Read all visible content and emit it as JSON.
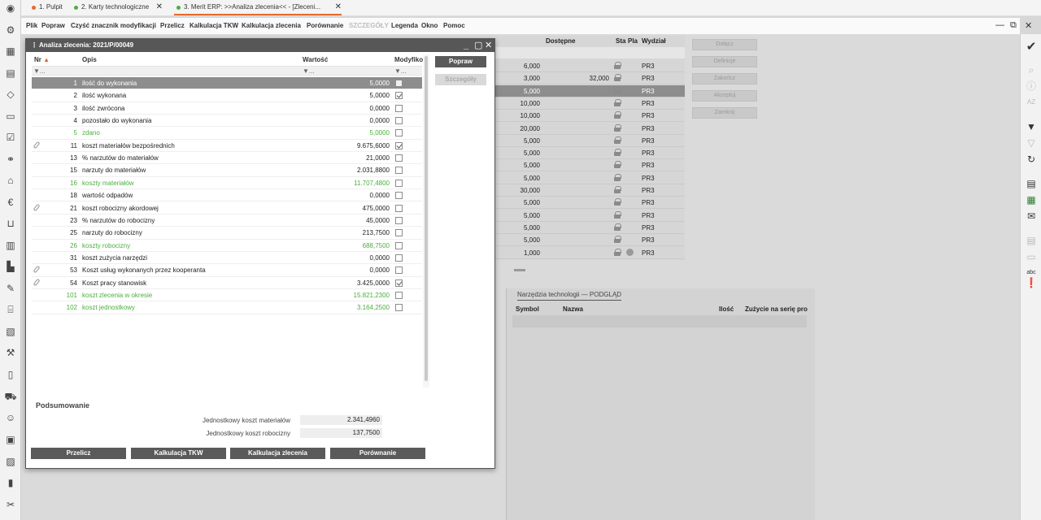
{
  "tabs": [
    {
      "label": "1. Pulpit",
      "dot": "#e36b2c",
      "closable": false
    },
    {
      "label": "2. Karty technologiczne",
      "dot": "#4caf3f",
      "closable": true
    },
    {
      "label": "3. Merit ERP: >>Analiza zlecenia<<  - [Zleceni...",
      "dot": "#4caf3f",
      "closable": true,
      "active": true
    }
  ],
  "menu": [
    {
      "label": "Plik"
    },
    {
      "label": "Popraw"
    },
    {
      "label": "Czyść znacznik modyfikacji"
    },
    {
      "label": "Przelicz"
    },
    {
      "label": "Kalkulacja TKW"
    },
    {
      "label": "Kalkulacja zlecenia"
    },
    {
      "label": "Porównanie"
    },
    {
      "label": "SZCZEGÓŁY",
      "disabled": true
    },
    {
      "label": "Legenda"
    },
    {
      "label": "Okno"
    },
    {
      "label": "Pomoc"
    }
  ],
  "window_controls": {
    "minimize": "—",
    "restore": "⧉",
    "close": "✕"
  },
  "background": {
    "headers": {
      "dostepne": "Dostępne",
      "sta": "Sta",
      "pla": "Pla",
      "wydzial": "Wydział"
    },
    "rows": [
      {
        "qty": "6,000",
        "dost": "",
        "wydzial": "PR3"
      },
      {
        "qty": "3,000",
        "dost": "32,000",
        "wydzial": "PR3"
      },
      {
        "qty": "5,000",
        "dost": "",
        "wydzial": "PR3",
        "selected": true
      },
      {
        "qty": "10,000",
        "dost": "",
        "wydzial": "PR3"
      },
      {
        "qty": "10,000",
        "dost": "",
        "wydzial": "PR3"
      },
      {
        "qty": "20,000",
        "dost": "",
        "wydzial": "PR3"
      },
      {
        "qty": "5,000",
        "dost": "",
        "wydzial": "PR3"
      },
      {
        "qty": "5,000",
        "dost": "",
        "wydzial": "PR3"
      },
      {
        "qty": "5,000",
        "dost": "",
        "wydzial": "PR3"
      },
      {
        "qty": "5,000",
        "dost": "",
        "wydzial": "PR3"
      },
      {
        "qty": "30,000",
        "dost": "",
        "wydzial": "PR3"
      },
      {
        "qty": "5,000",
        "dost": "",
        "wydzial": "PR3"
      },
      {
        "qty": "5,000",
        "dost": "",
        "wydzial": "PR3"
      },
      {
        "qty": "5,000",
        "dost": "",
        "wydzial": "PR3"
      },
      {
        "qty": "5,000",
        "dost": "",
        "wydzial": "PR3"
      },
      {
        "qty": "1,000",
        "dost": "",
        "wydzial": "PR3",
        "status": true
      }
    ],
    "buttons": [
      {
        "label": "Dołącz"
      },
      {
        "label": "Definicje"
      },
      {
        "label": "Zakończ"
      },
      {
        "label": "Akceptuj"
      },
      {
        "label": "Zamknij"
      }
    ],
    "tools_tab": "Narzędzia technologii — PODGLĄD",
    "tools_headers": {
      "symbol": "Symbol",
      "nazwa": "Nazwa",
      "ilosc": "Ilość",
      "zuzycie": "Zużycie na serię pro"
    }
  },
  "dialog": {
    "title": "Analiza zlecenia: 2021/P/00049",
    "columns": {
      "nr": "Nr",
      "opis": "Opis",
      "wartosc": "Wartość",
      "modyfikacja": "Modyfiko"
    },
    "filter_symbol": "▼...",
    "rows": [
      {
        "nr": "1",
        "opis": "ilość do wykonania",
        "val": "5,0000",
        "chk": false,
        "selected": true
      },
      {
        "nr": "2",
        "opis": "ilość wykonana",
        "val": "5,0000",
        "chk": true
      },
      {
        "nr": "3",
        "opis": "ilość zwrócona",
        "val": "0,0000",
        "chk": false
      },
      {
        "nr": "4",
        "opis": "pozostało do wykonania",
        "val": "0,0000",
        "chk": false
      },
      {
        "nr": "5",
        "opis": "zdano",
        "val": "5,0000",
        "chk": false,
        "sum": true
      },
      {
        "nr": "11",
        "opis": "koszt materiałów bezpośrednich",
        "val": "9.675,6000",
        "chk": true,
        "attach": true
      },
      {
        "nr": "13",
        "opis": "% narzutów do materiałów",
        "val": "21,0000",
        "chk": false
      },
      {
        "nr": "15",
        "opis": "narzuty do materiałów",
        "val": "2.031,8800",
        "chk": false
      },
      {
        "nr": "16",
        "opis": "koszty materiałów",
        "val": "11.707,4800",
        "chk": false,
        "sum": true
      },
      {
        "nr": "18",
        "opis": "wartość odpadów",
        "val": "0,0000",
        "chk": false
      },
      {
        "nr": "21",
        "opis": "koszt robocizny akordowej",
        "val": "475,0000",
        "chk": false,
        "attach": true
      },
      {
        "nr": "23",
        "opis": "% narzutów do robocizny",
        "val": "45,0000",
        "chk": false
      },
      {
        "nr": "25",
        "opis": "narzuty do robocizny",
        "val": "213,7500",
        "chk": false
      },
      {
        "nr": "26",
        "opis": "koszty robocizny",
        "val": "688,7500",
        "chk": false,
        "sum": true
      },
      {
        "nr": "31",
        "opis": "koszt zużycia narzędzi",
        "val": "0,0000",
        "chk": false
      },
      {
        "nr": "53",
        "opis": "Koszt usług wykonanych przez kooperanta",
        "val": "0,0000",
        "chk": false,
        "attach": true
      },
      {
        "nr": "54",
        "opis": "Koszt pracy stanowisk",
        "val": "3.425,0000",
        "chk": true,
        "attach": true
      },
      {
        "nr": "101",
        "opis": "koszt zlecenia w okresie",
        "val": "15.821,2300",
        "chk": false,
        "sum": true
      },
      {
        "nr": "102",
        "opis": "koszt jednostkowy",
        "val": "3.164,2500",
        "chk": false,
        "sum": true
      }
    ],
    "side_buttons": {
      "popraw": "Popraw",
      "szczegoly": "Szczegóły"
    },
    "summary": {
      "title": "Podsumowanie",
      "mat_label": "Jednostkowy koszt materiałów",
      "mat_value": "2.341,4960",
      "rob_label": "Jednostkowy koszt robocizny",
      "rob_value": "137,7500"
    },
    "bottom_buttons": [
      {
        "label": "Przelicz"
      },
      {
        "label": "Kalkulacja TKW"
      },
      {
        "label": "Kalkulacja zlecenia"
      },
      {
        "label": "Porównanie"
      }
    ]
  },
  "colors": {
    "accent": "#e36b2c",
    "green": "#4caf3f",
    "selected_row": "#8d8d8d",
    "dark_button": "#5a5a5a"
  }
}
